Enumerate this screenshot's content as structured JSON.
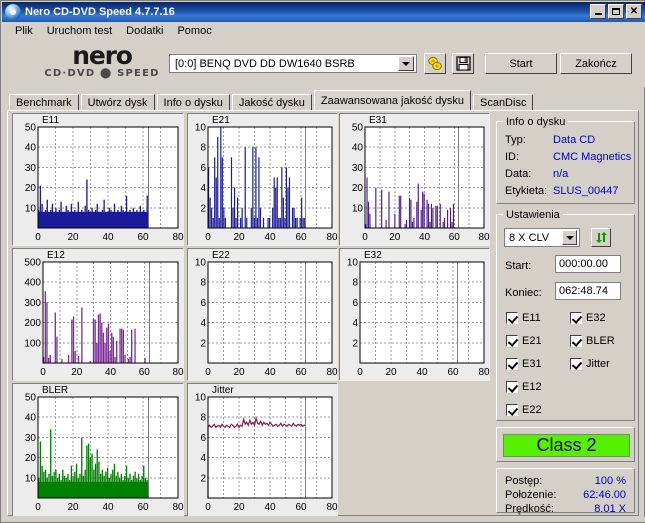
{
  "window": {
    "title": "Nero CD-DVD Speed 4.7.7.16",
    "icon": "nero-disc-icon",
    "buttons": {
      "minimize": "_",
      "maximize": "□",
      "close": "✕"
    }
  },
  "menu": {
    "items": [
      "Plik",
      "Uruchom test",
      "Dodatki",
      "Pomoc"
    ]
  },
  "toolbar": {
    "logo_word": "nero",
    "logo_sub": "CD·DVD ⬤ SPEED",
    "drive": "[0:0]   BENQ DVD DD DW1640 BSRB",
    "speed_icon": "yellow-disc-icon",
    "save_icon": "floppy-save-icon",
    "start_label": "Start",
    "quit_label": "Zakończ"
  },
  "tabs": {
    "items": [
      {
        "label": "Benchmark",
        "active": false
      },
      {
        "label": "Utwórz dysk",
        "active": false
      },
      {
        "label": "Info o dysku",
        "active": false
      },
      {
        "label": "Jakość dysku",
        "active": false
      },
      {
        "label": "Zaawansowana jakość dysku",
        "active": true
      },
      {
        "label": "ScanDisc",
        "active": false
      }
    ]
  },
  "disc_info": {
    "title": "Info o dysku",
    "rows": [
      {
        "key": "Typ:",
        "value": "Data CD"
      },
      {
        "key": "ID:",
        "value": "CMC Magnetics"
      },
      {
        "key": "Data:",
        "value": "n/a"
      },
      {
        "key": "Etykieta:",
        "value": "SLUS_00447"
      }
    ]
  },
  "settings": {
    "title": "Ustawienia",
    "speed": "8 X CLV",
    "refresh_icon": "refresh-arrows-icon",
    "start_label": "Start:",
    "start_value": "000:00.00",
    "end_label": "Koniec:",
    "end_value": "062:48.74",
    "checkboxes_left": [
      {
        "label": "E11",
        "checked": true
      },
      {
        "label": "E21",
        "checked": true
      },
      {
        "label": "E31",
        "checked": true
      },
      {
        "label": "E12",
        "checked": true
      },
      {
        "label": "E22",
        "checked": true
      }
    ],
    "checkboxes_right": [
      {
        "label": "E32",
        "checked": true
      },
      {
        "label": "BLER",
        "checked": true
      },
      {
        "label": "Jitter",
        "checked": true
      }
    ]
  },
  "class_badge": {
    "label": "Class 2",
    "color": "#54f000"
  },
  "status": {
    "rows": [
      {
        "key": "Postęp:",
        "value": "100 %"
      },
      {
        "key": "Położenie:",
        "value": "62:46.00"
      },
      {
        "key": "Prędkość:",
        "value": "8.01 X"
      }
    ]
  },
  "chart_data": [
    {
      "type": "bar",
      "name": "E11",
      "title": "E11",
      "color": "#1a1a9a",
      "xlabel": "",
      "ylabel": "",
      "xlim": [
        0,
        80
      ],
      "ylim": [
        0,
        50
      ],
      "xticks": [
        0,
        20,
        40,
        60,
        80
      ],
      "yticks": [
        10,
        20,
        30,
        40,
        50
      ],
      "grid": true,
      "scan_end_marker": 63,
      "baseline": 8,
      "values": [
        9,
        21,
        12,
        8,
        9,
        14,
        7,
        9,
        12,
        8,
        10,
        7,
        9,
        13,
        8,
        7,
        11,
        9,
        8,
        12,
        7,
        9,
        8,
        13,
        7,
        9,
        8,
        11,
        24,
        9,
        8,
        10,
        7,
        9,
        12,
        8,
        7,
        9,
        14,
        8,
        7,
        10,
        9,
        8,
        12,
        7,
        9,
        8,
        11,
        9,
        7,
        16,
        8,
        9,
        7,
        10,
        8,
        9,
        7,
        11,
        8,
        9,
        7,
        16
      ]
    },
    {
      "type": "bar",
      "name": "E21",
      "title": "E21",
      "color": "#1a1a9a",
      "xlim": [
        0,
        80
      ],
      "ylim": [
        0,
        10
      ],
      "xticks": [
        0,
        20,
        40,
        60,
        80
      ],
      "yticks": [
        2,
        4,
        6,
        8,
        10
      ],
      "grid": true,
      "scan_end_marker": 63,
      "baseline": 0,
      "values": [
        6,
        3,
        2,
        1,
        7,
        5,
        9,
        1,
        10,
        7,
        2,
        1,
        0,
        0,
        0,
        7,
        2,
        4,
        1,
        3,
        0,
        1,
        2,
        0,
        8,
        1,
        0,
        0,
        2,
        8,
        1,
        8,
        1,
        7,
        2,
        0,
        1,
        0,
        0,
        1,
        1,
        0,
        2,
        5,
        4,
        5,
        1,
        1,
        6,
        3,
        1,
        6,
        4,
        5,
        0,
        2,
        2,
        1,
        1,
        0,
        1,
        3,
        1,
        1
      ]
    },
    {
      "type": "bar",
      "name": "E31",
      "title": "E31",
      "color": "#4a1a8a",
      "xlim": [
        0,
        80
      ],
      "ylim": [
        0,
        50
      ],
      "xticks": [
        0,
        20,
        40,
        60,
        80
      ],
      "yticks": [
        10,
        20,
        30,
        40,
        50
      ],
      "grid": true,
      "scan_end_marker": 63,
      "baseline": 0,
      "values": [
        2,
        25,
        13,
        7,
        0,
        0,
        0,
        20,
        0,
        0,
        0,
        19,
        0,
        0,
        4,
        0,
        18,
        0,
        0,
        0,
        7,
        0,
        0,
        16,
        16,
        0,
        0,
        2,
        4,
        0,
        15,
        14,
        3,
        5,
        0,
        13,
        22,
        0,
        9,
        18,
        17,
        0,
        14,
        12,
        3,
        12,
        10,
        0,
        11,
        11,
        0,
        12,
        0,
        3,
        5,
        0,
        9,
        0,
        10,
        3,
        12,
        0,
        0,
        0
      ]
    },
    {
      "type": "bar",
      "name": "E12",
      "title": "E12",
      "color": "#7a2a9a",
      "xlim": [
        0,
        80
      ],
      "ylim": [
        0,
        500
      ],
      "xticks": [
        0,
        20,
        40,
        60,
        80
      ],
      "yticks": [
        100,
        200,
        300,
        400,
        500
      ],
      "grid": true,
      "scan_end_marker": 63,
      "baseline": 0,
      "values": [
        30,
        355,
        300,
        25,
        40,
        0,
        0,
        250,
        130,
        0,
        0,
        20,
        0,
        0,
        0,
        40,
        0,
        215,
        230,
        60,
        0,
        35,
        0,
        275,
        0,
        0,
        0,
        0,
        10,
        0,
        220,
        215,
        100,
        240,
        245,
        200,
        150,
        100,
        175,
        195,
        60,
        150,
        130,
        30,
        110,
        0,
        170,
        170,
        165,
        40,
        0,
        20,
        30,
        165,
        0,
        170,
        0,
        0,
        0,
        0,
        0,
        25,
        0,
        0
      ]
    },
    {
      "type": "bar",
      "name": "E22",
      "title": "E22",
      "color": "#1a1a9a",
      "xlim": [
        0,
        80
      ],
      "ylim": [
        0,
        10
      ],
      "xticks": [
        0,
        20,
        40,
        60,
        80
      ],
      "yticks": [
        2,
        4,
        6,
        8,
        10
      ],
      "grid": true,
      "scan_end_marker": 63,
      "baseline": 0,
      "values": []
    },
    {
      "type": "bar",
      "name": "E32",
      "title": "E32",
      "color": "#1a1a9a",
      "xlim": [
        0,
        80
      ],
      "ylim": [
        0,
        10
      ],
      "xticks": [
        0,
        20,
        40,
        60,
        80
      ],
      "yticks": [
        2,
        4,
        6,
        8,
        10
      ],
      "grid": true,
      "scan_end_marker": 63,
      "baseline": 0,
      "values": []
    },
    {
      "type": "bar",
      "name": "BLER",
      "title": "BLER",
      "color": "#008000",
      "xlim": [
        0,
        80
      ],
      "ylim": [
        0,
        50
      ],
      "xticks": [
        0,
        20,
        40,
        60,
        80
      ],
      "yticks": [
        10,
        20,
        30,
        40,
        50
      ],
      "grid": true,
      "scan_end_marker": 63,
      "baseline": 8,
      "values": [
        10,
        28,
        16,
        13,
        14,
        10,
        12,
        34,
        11,
        13,
        14,
        10,
        12,
        9,
        14,
        11,
        10,
        12,
        9,
        16,
        11,
        13,
        17,
        10,
        12,
        30,
        11,
        14,
        26,
        27,
        20,
        22,
        14,
        17,
        24,
        18,
        12,
        14,
        11,
        13,
        15,
        10,
        12,
        14,
        17,
        11,
        13,
        10,
        12,
        9,
        11,
        16,
        10,
        12,
        9,
        11,
        13,
        10,
        12,
        9,
        11,
        16,
        10,
        9
      ]
    },
    {
      "type": "line",
      "name": "Jitter",
      "title": "Jitter",
      "color": "#8b1a4a",
      "xlim": [
        0,
        80
      ],
      "ylim": [
        0,
        10
      ],
      "xticks": [
        0,
        20,
        40,
        60,
        80
      ],
      "yticks": [
        2,
        4,
        6,
        8,
        10
      ],
      "grid": true,
      "scan_end_marker": 63,
      "baseline": 0,
      "values": [
        7.0,
        7.2,
        7.0,
        7.1,
        7.3,
        7.0,
        7.1,
        7.2,
        7.0,
        7.3,
        7.1,
        7.0,
        7.2,
        7.1,
        7.0,
        7.3,
        7.2,
        7.0,
        7.1,
        7.3,
        7.0,
        7.2,
        7.1,
        7.8,
        7.3,
        7.5,
        7.2,
        7.7,
        7.3,
        7.5,
        7.2,
        7.9,
        7.4,
        7.3,
        7.6,
        7.2,
        7.5,
        7.3,
        7.4,
        7.2,
        7.5,
        7.3,
        7.1,
        7.2,
        7.3,
        7.1,
        7.2,
        7.4,
        7.1,
        7.3,
        7.2,
        7.1,
        7.3,
        7.2,
        7.1,
        7.4,
        7.2,
        7.1,
        7.3,
        7.2,
        7.3,
        7.1,
        7.2,
        7.2
      ]
    }
  ]
}
